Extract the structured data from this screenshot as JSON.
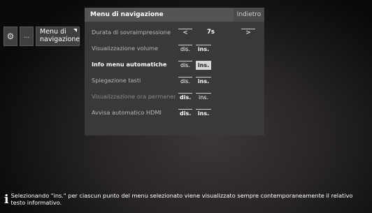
{
  "breadcrumb": {
    "gear_icon": "gear-icon",
    "dots_label": "...",
    "current_label": "Menu di navigazione"
  },
  "menu": {
    "title": "Menu di navigazione",
    "back_label": "Indietro",
    "rows": [
      {
        "label": "Durata di sovraimpressione",
        "prev": "<",
        "value": "7s",
        "next": ">"
      },
      {
        "label": "Visualizzazione volume",
        "dis": "dis.",
        "ins": "ins.",
        "selected": "ins."
      },
      {
        "label": "Info menu automatiche",
        "dis": "dis.",
        "ins": "ins.",
        "selected": "ins."
      },
      {
        "label": "Spiegazione tasti",
        "dis": "dis.",
        "ins": "ins.",
        "selected": "ins."
      },
      {
        "label": "Visualizzazione ora permanente",
        "dis": "dis.",
        "ins": "ins.",
        "selected": "dis."
      },
      {
        "label": "Avvisa automatico HDMI",
        "dis": "dis.",
        "ins": "ins.",
        "selected": "dis."
      }
    ]
  },
  "info": {
    "icon": "info-icon",
    "text": "Selezionando \"ins.\" per ciascun punto del menu selezionato viene visualizzato sempre contemporaneamente il relativo testo informativo."
  }
}
